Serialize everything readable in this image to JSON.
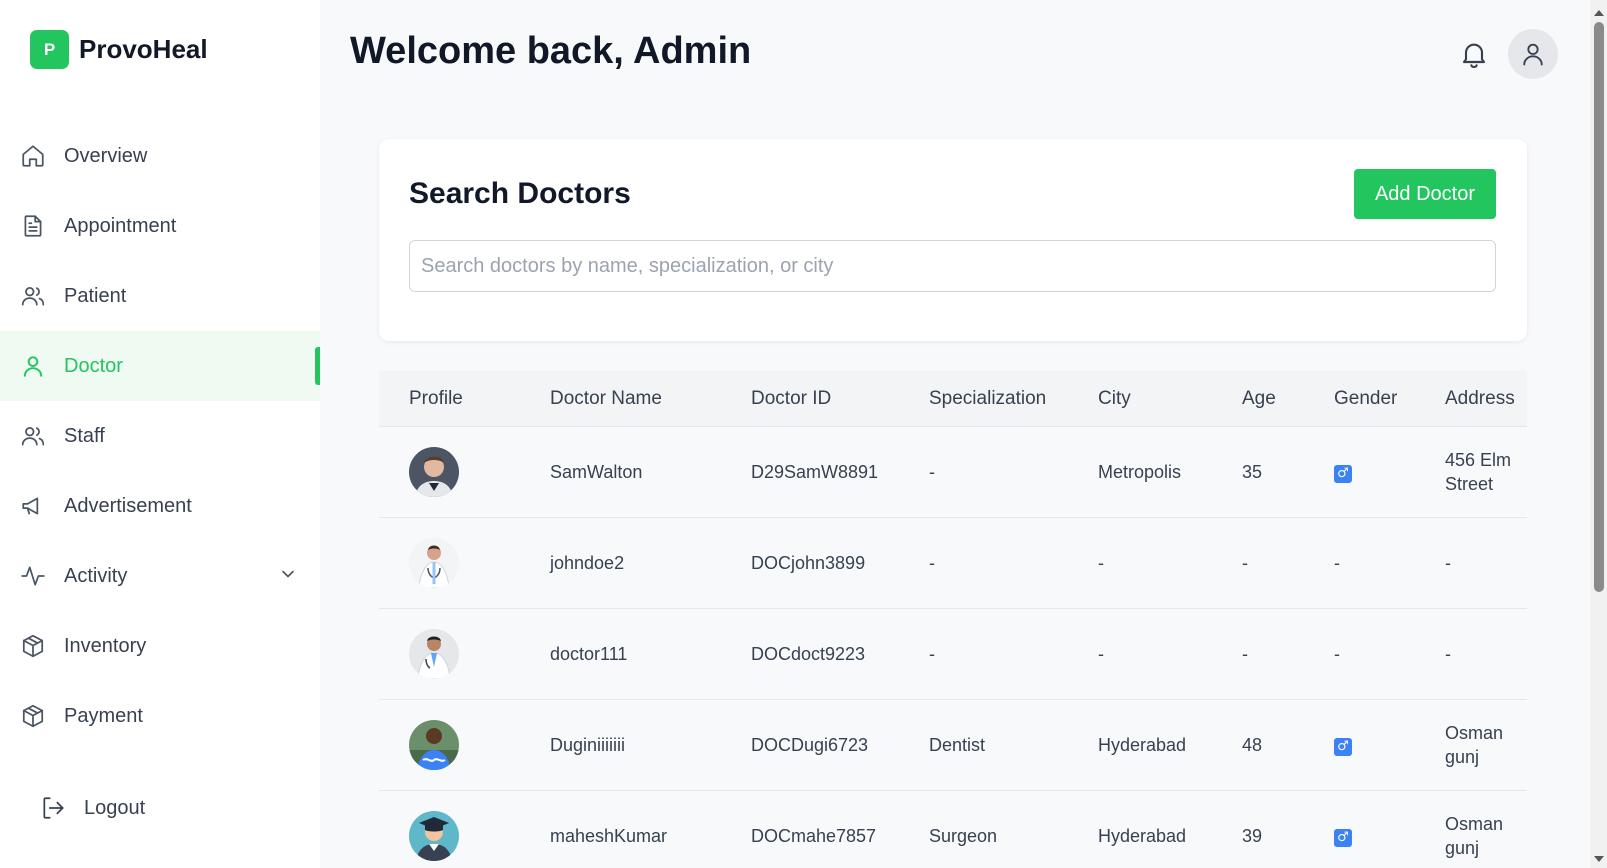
{
  "brand": {
    "logo_letter": "P",
    "name": "ProvoHeal"
  },
  "sidebar": {
    "items": [
      {
        "label": "Overview",
        "icon": "home-icon"
      },
      {
        "label": "Appointment",
        "icon": "document-icon"
      },
      {
        "label": "Patient",
        "icon": "users-icon"
      },
      {
        "label": "Doctor",
        "icon": "user-icon",
        "active": true
      },
      {
        "label": "Staff",
        "icon": "users-icon"
      },
      {
        "label": "Advertisement",
        "icon": "megaphone-icon"
      },
      {
        "label": "Activity",
        "icon": "activity-icon",
        "has_submenu": true
      },
      {
        "label": "Inventory",
        "icon": "package-icon"
      },
      {
        "label": "Payment",
        "icon": "package-icon"
      }
    ],
    "logout_label": "Logout"
  },
  "header": {
    "title": "Welcome back, Admin"
  },
  "search": {
    "title": "Search Doctors",
    "add_button": "Add Doctor",
    "placeholder": "Search doctors by name, specialization, or city"
  },
  "table": {
    "columns": [
      "Profile",
      "Doctor Name",
      "Doctor ID",
      "Specialization",
      "City",
      "Age",
      "Gender",
      "Address"
    ],
    "rows": [
      {
        "name": "SamWalton",
        "id": "D29SamW8891",
        "specialization": "-",
        "city": "Metropolis",
        "age": "35",
        "gender": "♂",
        "address": "456 Elm Street"
      },
      {
        "name": "johndoe2",
        "id": "DOCjohn3899",
        "specialization": "-",
        "city": "-",
        "age": "-",
        "gender": "-",
        "address": "-"
      },
      {
        "name": "doctor111",
        "id": "DOCdoct9223",
        "specialization": "-",
        "city": "-",
        "age": "-",
        "gender": "-",
        "address": "-"
      },
      {
        "name": "Duginiiiiiii",
        "id": "DOCDugi6723",
        "specialization": "Dentist",
        "city": "Hyderabad",
        "age": "48",
        "gender": "♂",
        "address": "Osman gunj"
      },
      {
        "name": "maheshKumar",
        "id": "DOCmahe7857",
        "specialization": "Surgeon",
        "city": "Hyderabad",
        "age": "39",
        "gender": "♂",
        "address": "Osman gunj"
      }
    ]
  },
  "colors": {
    "accent": "#22c55e",
    "active_bg": "#effbf2",
    "gender_badge": "#3b82f6"
  }
}
